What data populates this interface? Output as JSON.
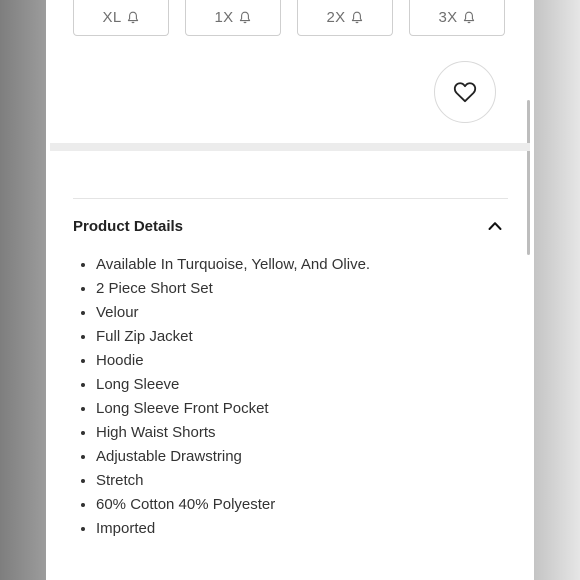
{
  "sizes": [
    {
      "label": "XL"
    },
    {
      "label": "1X"
    },
    {
      "label": "2X"
    },
    {
      "label": "3X"
    }
  ],
  "icons": {
    "size_alert": "bell-icon",
    "like": "heart-icon",
    "collapse": "chevron-up-icon"
  },
  "product_details": {
    "title": "Product Details",
    "expanded": true,
    "items": [
      "Available In Turquoise, Yellow, And Olive.",
      "2 Piece Short Set",
      "Velour",
      "Full Zip Jacket",
      "Hoodie",
      "Long Sleeve",
      "Long Sleeve Front Pocket",
      "High Waist Shorts",
      "Adjustable Drawstring",
      "Stretch",
      "60% Cotton 40% Polyester",
      "Imported"
    ]
  },
  "colors": {
    "text": "#333333",
    "border": "#cfcfcf",
    "muted": "#6f6f6f"
  }
}
